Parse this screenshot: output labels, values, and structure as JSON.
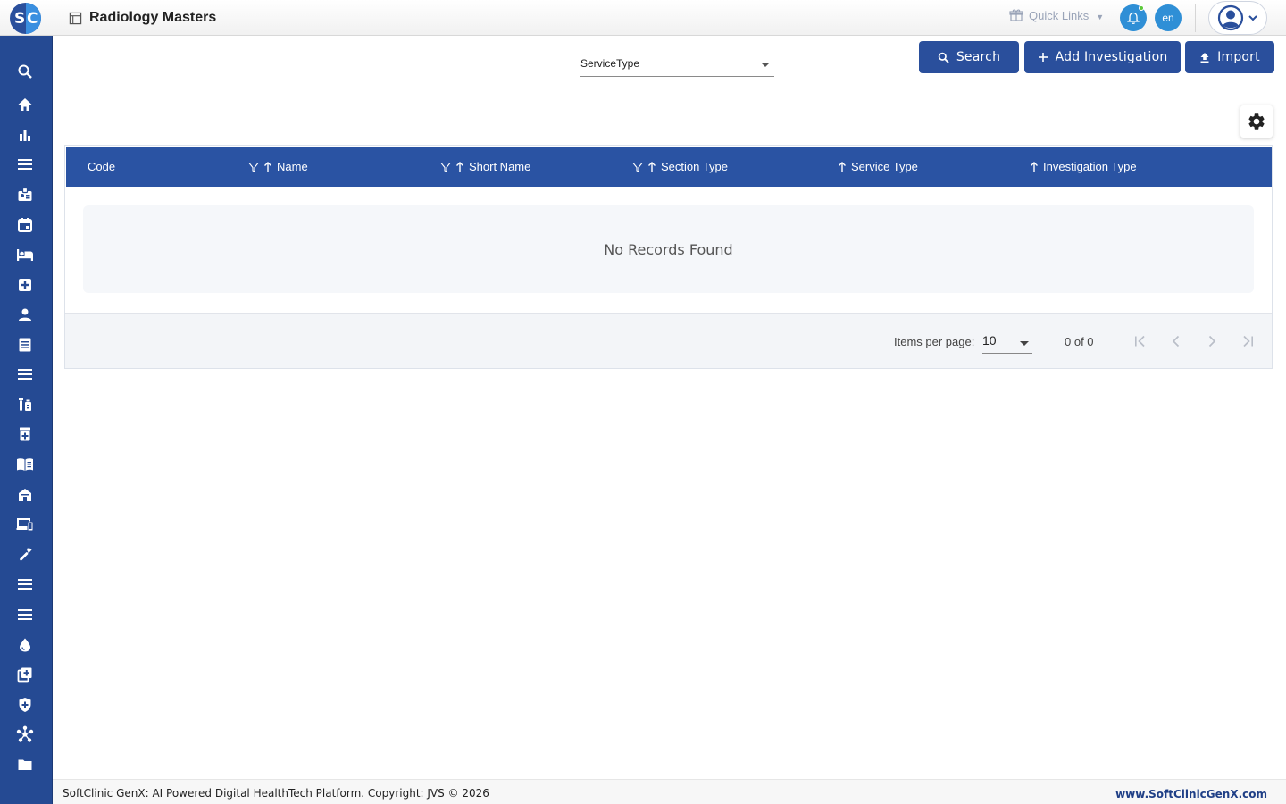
{
  "app": {
    "logo_letters": [
      "S",
      "C"
    ],
    "page_title": "Radiology Masters"
  },
  "header": {
    "quick_links_label": "Quick Links",
    "language_code": "en",
    "icons": [
      "gift-icon",
      "bell-icon",
      "user-avatar-icon",
      "chevron-down-icon"
    ],
    "accent_color": "#2f8fd6"
  },
  "sidebar": {
    "background_color": "#254a93",
    "items": [
      {
        "icon": "search-icon"
      },
      {
        "icon": "home-icon"
      },
      {
        "icon": "bar-chart-icon"
      },
      {
        "icon": "menu-icon"
      },
      {
        "icon": "badge-icon"
      },
      {
        "icon": "calendar-icon"
      },
      {
        "icon": "bed-icon"
      },
      {
        "icon": "medical-plus-icon"
      },
      {
        "icon": "person-icon"
      },
      {
        "icon": "receipt-icon"
      },
      {
        "icon": "menu-icon"
      },
      {
        "icon": "lab-icon"
      },
      {
        "icon": "medicine-icon"
      },
      {
        "icon": "book-icon"
      },
      {
        "icon": "store-icon"
      },
      {
        "icon": "devices-icon"
      },
      {
        "icon": "wrench-icon"
      },
      {
        "icon": "menu-icon"
      },
      {
        "icon": "menu-icon"
      },
      {
        "icon": "drop-icon"
      },
      {
        "icon": "add-box-icon"
      },
      {
        "icon": "shield-icon"
      },
      {
        "icon": "network-icon"
      },
      {
        "icon": "folder-icon"
      }
    ]
  },
  "toolbar": {
    "filter_value": "ServiceType",
    "search_label": "Search",
    "add_label": "Add Investigation",
    "import_label": "Import",
    "button_color": "#2a4f9c"
  },
  "table": {
    "header_color": "#2a53a3",
    "columns": [
      {
        "label": "Code",
        "filter": false,
        "sort": false
      },
      {
        "label": "Name",
        "filter": true,
        "sort": true
      },
      {
        "label": "Short Name",
        "filter": true,
        "sort": true
      },
      {
        "label": "Section Type",
        "filter": true,
        "sort": true
      },
      {
        "label": "Service Type",
        "filter": false,
        "sort": true
      },
      {
        "label": "Investigation Type",
        "filter": false,
        "sort": true
      }
    ],
    "rows": [],
    "empty_message": "No Records Found"
  },
  "paginator": {
    "items_per_page_label": "Items per page:",
    "items_per_page_value": "10",
    "range_label": "0 of 0"
  },
  "footer": {
    "copyright": "SoftClinic GenX: AI Powered Digital HealthTech Platform. Copyright: JVS © 2026",
    "website": "www.SoftClinicGenX.com"
  }
}
